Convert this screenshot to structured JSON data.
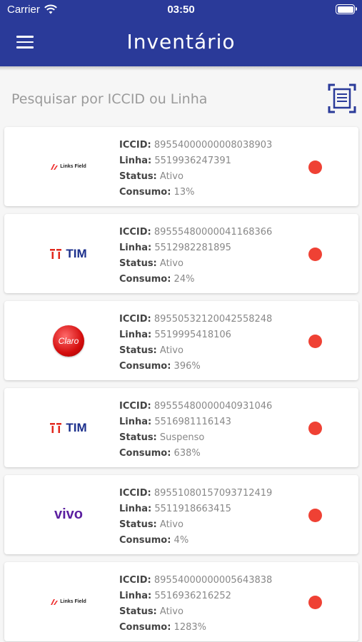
{
  "status_bar": {
    "carrier": "Carrier",
    "time": "03:50"
  },
  "header": {
    "title": "Inventário"
  },
  "search": {
    "placeholder": "Pesquisar por ICCID ou Linha"
  },
  "labels": {
    "iccid": "ICCID:",
    "linha": "Linha:",
    "status": "Status:",
    "consumo": "Consumo:"
  },
  "colors": {
    "header": "#2a3a99",
    "status_dot": "#ef4134",
    "tim": "#1b2f8c",
    "vivo": "#5b1fa0",
    "claro": "#d40d0d"
  },
  "items": [
    {
      "logo": "links-field",
      "logo_text": "Links Field",
      "iccid": "89554000000008038903",
      "linha": "5519936247391",
      "status": "Ativo",
      "consumo": "13%"
    },
    {
      "logo": "tim",
      "logo_text": "TIM",
      "iccid": "89555480000041168366",
      "linha": "5512982281895",
      "status": "Ativo",
      "consumo": "24%"
    },
    {
      "logo": "claro",
      "logo_text": "Claro",
      "iccid": "89550532120042558248",
      "linha": "5519995418106",
      "status": "Ativo",
      "consumo": "396%"
    },
    {
      "logo": "tim",
      "logo_text": "TIM",
      "iccid": "89555480000040931046",
      "linha": "5516981116143",
      "status": "Suspenso",
      "consumo": "638%"
    },
    {
      "logo": "vivo",
      "logo_text": "vivo",
      "iccid": "89551080157093712419",
      "linha": "5511918663415",
      "status": "Ativo",
      "consumo": "4%"
    },
    {
      "logo": "links-field",
      "logo_text": "Links Field",
      "iccid": "89554000000005643838",
      "linha": "5516936216252",
      "status": "Ativo",
      "consumo": "1283%"
    }
  ]
}
